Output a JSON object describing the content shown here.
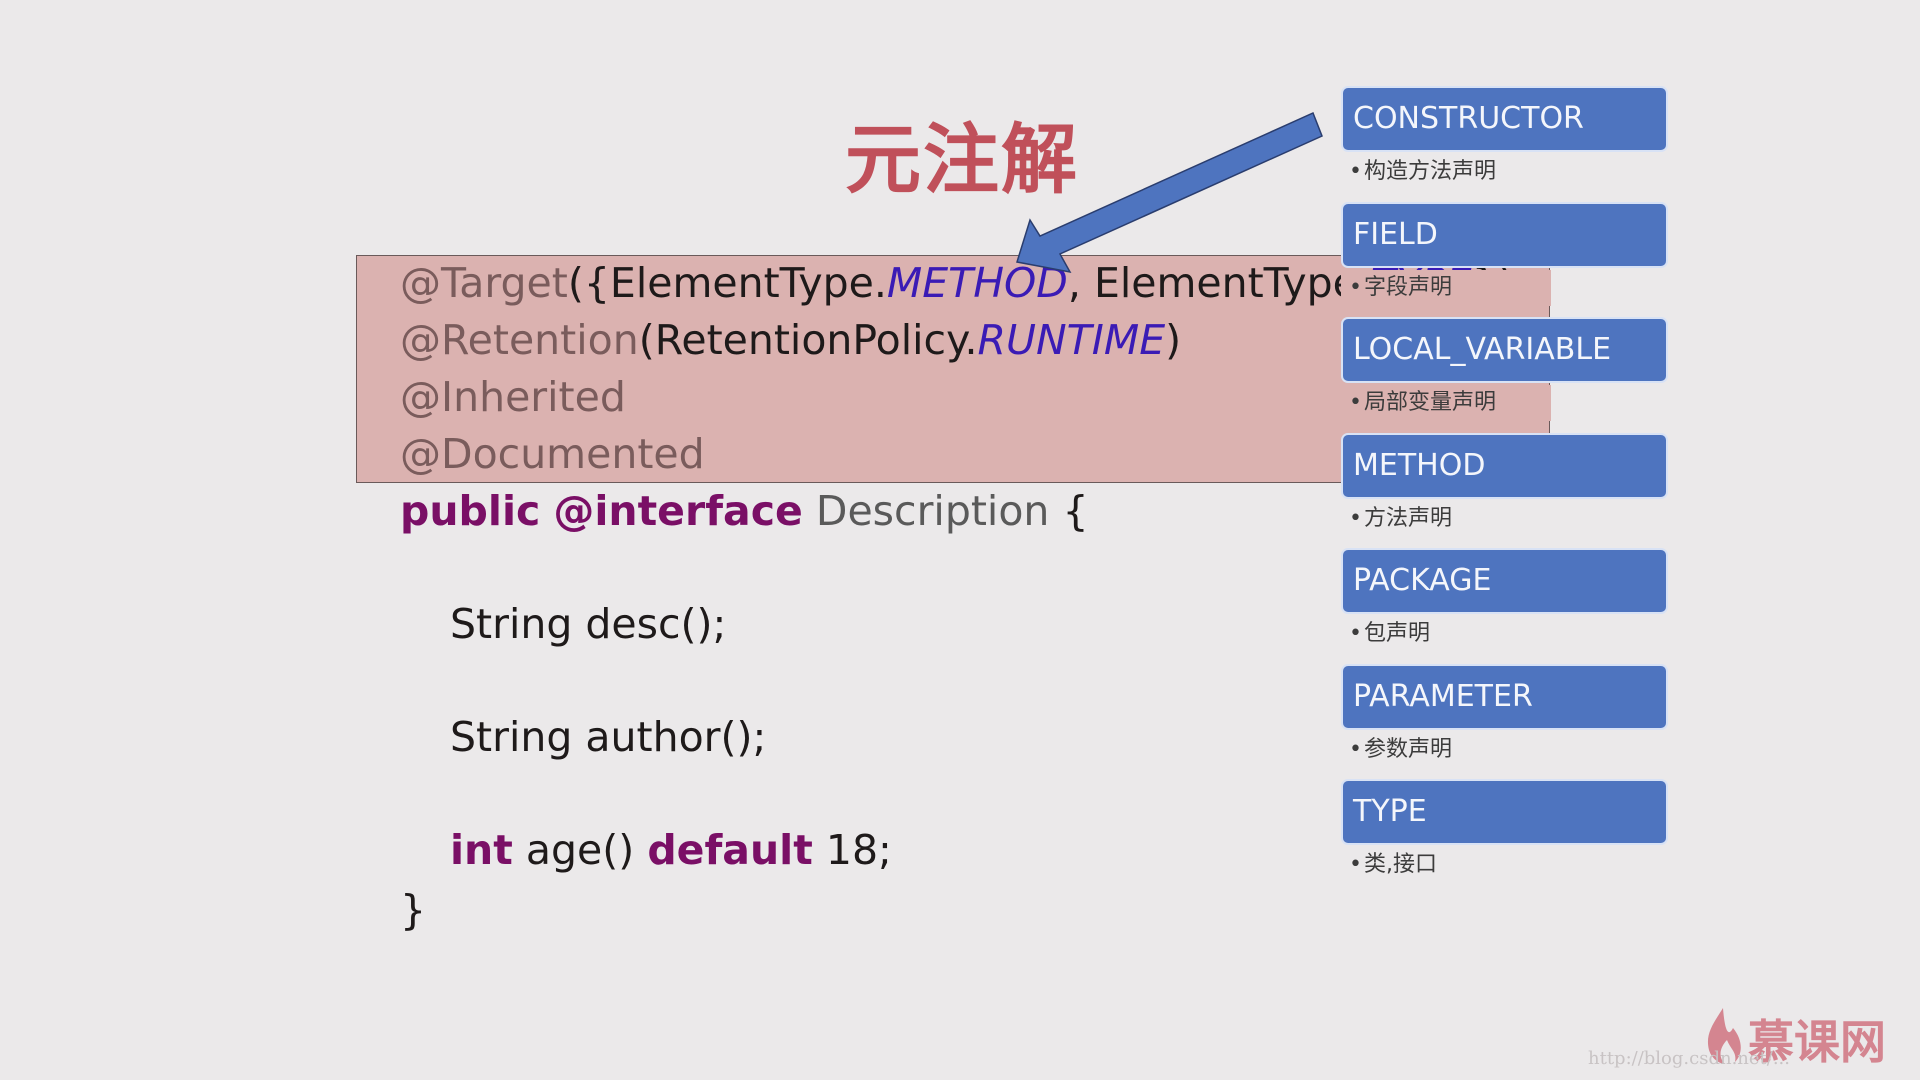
{
  "slide": {
    "title": "元注解",
    "meta_annotations": {
      "line1": {
        "prefix": "@Target",
        "open": "({ElementType.",
        "value1": "METHOD",
        "sep": ", ElementType.",
        "value2": "TYPE",
        "close": "})"
      },
      "line2": {
        "prefix": "@Retention",
        "open": "(RetentionPolicy.",
        "value": "RUNTIME",
        "close": ")"
      },
      "line3": "@Inherited",
      "line4": "@Documented"
    },
    "declaration": {
      "kw1": "public",
      "kw2": "@interface",
      "name": "Description",
      "brace": "{"
    },
    "members": {
      "m1": "String desc();",
      "m2": "String author();",
      "m3": {
        "type": "int",
        "sig": "age()",
        "kw": "default",
        "value": "18;"
      }
    },
    "closing_brace": "}"
  },
  "element_types": [
    {
      "name": "CONSTRUCTOR",
      "desc": "构造方法声明"
    },
    {
      "name": "FIELD",
      "desc": "字段声明"
    },
    {
      "name": "LOCAL_VARIABLE",
      "desc": "局部变量声明"
    },
    {
      "name": "METHOD",
      "desc": "方法声明"
    },
    {
      "name": "PACKAGE",
      "desc": "包声明"
    },
    {
      "name": "PARAMETER",
      "desc": "参数声明"
    },
    {
      "name": "TYPE",
      "desc": "类,接口"
    }
  ],
  "bullet": "•",
  "watermark": {
    "logo_text": "慕课网",
    "url": "http://blog.csdn.net/..."
  },
  "colors": {
    "title": "#c0505a",
    "tag_bg": "#4e74bf",
    "highlight": "#dbb2b0",
    "keyword": "#7a0f66",
    "enum_value": "#3a1bb5"
  }
}
